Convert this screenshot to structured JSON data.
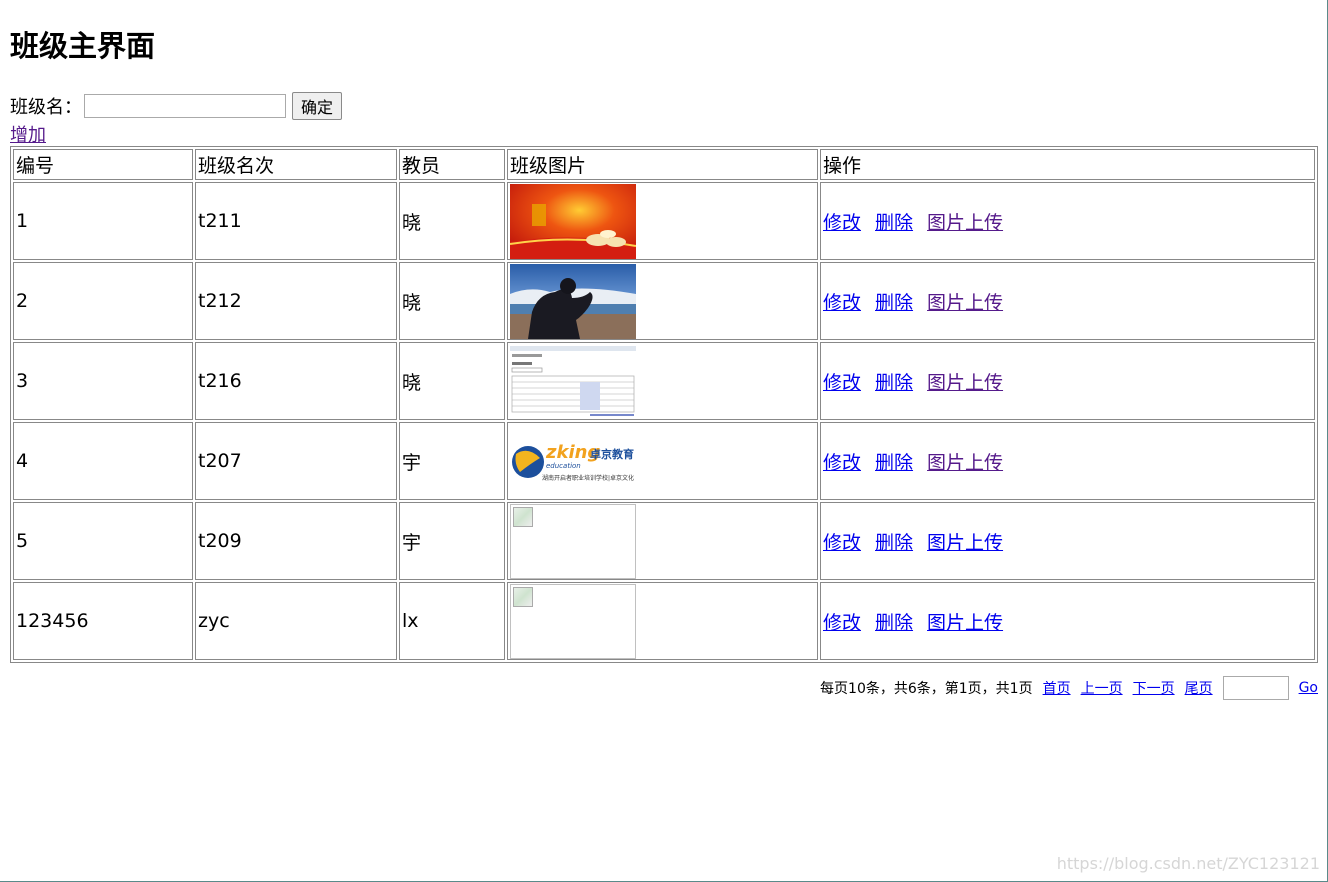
{
  "page": {
    "title": "班级主界面"
  },
  "search": {
    "label": "班级名：",
    "value": "",
    "confirm_label": "确定"
  },
  "add_label": "增加",
  "table": {
    "headers": [
      "编号",
      "班级名次",
      "教员",
      "班级图片",
      "操作"
    ],
    "rows": [
      {
        "id": "1",
        "name": "t211",
        "teacher": "晓",
        "image": "festival-red"
      },
      {
        "id": "2",
        "name": "t212",
        "teacher": "晓",
        "image": "person-seaside"
      },
      {
        "id": "3",
        "name": "t216",
        "teacher": "晓",
        "image": "webpage-screenshot"
      },
      {
        "id": "4",
        "name": "t207",
        "teacher": "宇",
        "image": "zking-logo"
      },
      {
        "id": "5",
        "name": "t209",
        "teacher": "宇",
        "image": "broken"
      },
      {
        "id": "123456",
        "name": "zyc",
        "teacher": "lx",
        "image": "broken"
      }
    ],
    "actions": {
      "edit": "修改",
      "delete": "删除",
      "upload": "图片上传"
    }
  },
  "pager": {
    "summary": "每页10条，共6条，第1页，共1页",
    "first": "首页",
    "prev": "上一页",
    "next": "下一页",
    "last": "尾页",
    "go": "Go",
    "page_value": ""
  },
  "zking_logo": {
    "brand": "zking",
    "brand_cn": "卓京教育",
    "sub": "education",
    "slogan": "湖南开启者职业培训学校|卓京文化"
  },
  "watermark": "https://blog.csdn.net/ZYC123121"
}
